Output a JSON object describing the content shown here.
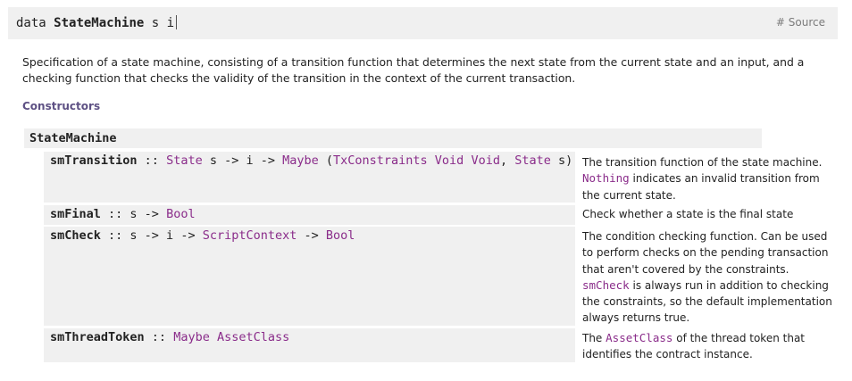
{
  "decl": {
    "keyword": "data",
    "name": "StateMachine",
    "params": "s i"
  },
  "source_link": "# Source",
  "description": "Specification of a state machine, consisting of a transition function that determines the next state from the current state and an input, and a checking function that checks the validity of the transition in the context of the current transaction.",
  "constructors_heading": "Constructors",
  "constructor_name": "StateMachine",
  "fields": [
    {
      "name": "smTransition",
      "sep": " :: ",
      "sig_parts": [
        {
          "t": "State",
          "ty": true
        },
        {
          "t": " s -> i -> ",
          "ty": false
        },
        {
          "t": "Maybe",
          "ty": true
        },
        {
          "t": " (",
          "ty": false
        },
        {
          "t": "TxConstraints Void Void",
          "ty": true
        },
        {
          "t": ", ",
          "ty": false
        },
        {
          "t": "State",
          "ty": true
        },
        {
          "t": " s)",
          "ty": false
        }
      ],
      "doc_parts": [
        {
          "t": "The transition function of the state machine. ",
          "c": false
        },
        {
          "t": "Nothing",
          "c": true
        },
        {
          "t": " indicates an invalid transition from the current state.",
          "c": false
        }
      ]
    },
    {
      "name": "smFinal",
      "sep": " :: ",
      "sig_parts": [
        {
          "t": "s -> ",
          "ty": false
        },
        {
          "t": "Bool",
          "ty": true
        }
      ],
      "doc_parts": [
        {
          "t": "Check whether a state is the final state",
          "c": false
        }
      ]
    },
    {
      "name": "smCheck",
      "sep": " :: ",
      "sig_parts": [
        {
          "t": "s -> i -> ",
          "ty": false
        },
        {
          "t": "ScriptContext",
          "ty": true
        },
        {
          "t": " -> ",
          "ty": false
        },
        {
          "t": "Bool",
          "ty": true
        }
      ],
      "doc_parts": [
        {
          "t": "The condition checking function. Can be used to perform checks on the pending transaction that aren't covered by the constraints. ",
          "c": false
        },
        {
          "t": "smCheck",
          "c": true
        },
        {
          "t": " is always run in addition to checking the constraints, so the default implementation always returns true.",
          "c": false
        }
      ]
    },
    {
      "name": "smThreadToken",
      "sep": " :: ",
      "sig_parts": [
        {
          "t": "Maybe AssetClass",
          "ty": true
        }
      ],
      "doc_parts": [
        {
          "t": "The ",
          "c": false
        },
        {
          "t": "AssetClass",
          "c": true
        },
        {
          "t": " of the thread token that identifies the contract instance.",
          "c": false
        }
      ]
    }
  ]
}
